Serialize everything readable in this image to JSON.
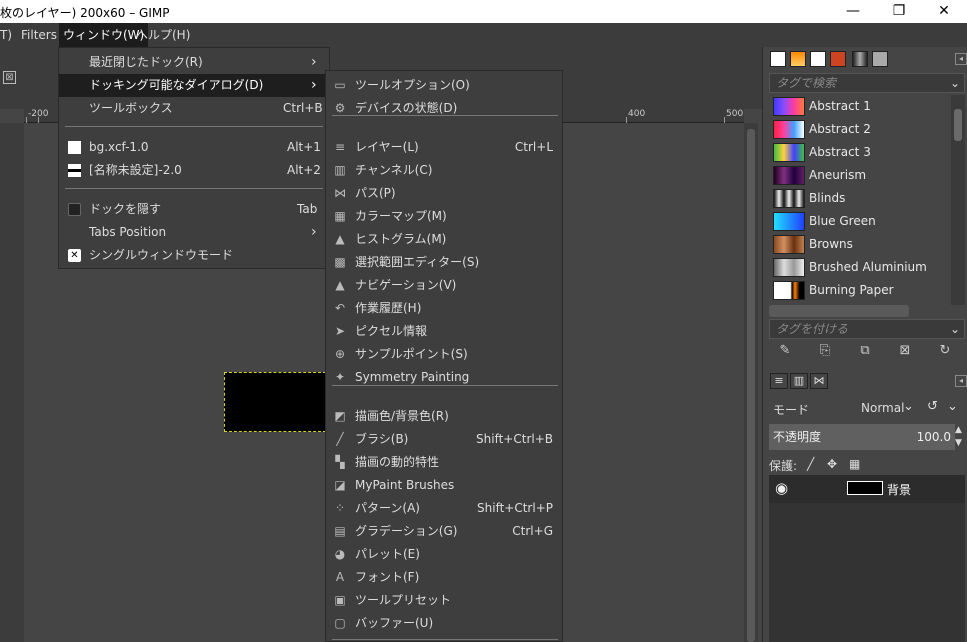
{
  "titlebar": {
    "title": "枚のレイヤー) 200x60 – GIMP",
    "minimize": "—",
    "maximize": "❐",
    "close": "✕"
  },
  "menubar": {
    "items": [
      "T)",
      "Filters",
      "ウィンドウ(W)",
      "ヘルプ(H)"
    ]
  },
  "ruler": {
    "labels": [
      "-200",
      "400",
      "500"
    ]
  },
  "window_menu": {
    "items": [
      {
        "label": "最近閉じたドック(R)",
        "arrow": "›"
      },
      {
        "label": "ドッキング可能なダイアログ(D)",
        "arrow": "›"
      },
      {
        "label": "ツールボックス",
        "shortcut": "Ctrl+B"
      },
      {
        "label": "bg.xcf-1.0",
        "shortcut": "Alt+1"
      },
      {
        "label": "[名称未設定]-2.0",
        "shortcut": "Alt+2"
      },
      {
        "label": "ドックを隠す",
        "shortcut": "Tab"
      },
      {
        "label": "Tabs Position",
        "arrow": "›"
      },
      {
        "label": "シングルウィンドウモード"
      }
    ]
  },
  "dockable_menu": {
    "items": [
      {
        "label": "ツールオプション(O)",
        "icon": "tool-options-icon",
        "glyph": "▭"
      },
      {
        "label": "デバイスの状態(D)",
        "icon": "device-status-icon",
        "glyph": "⚙"
      },
      {
        "label": "レイヤー(L)",
        "shortcut": "Ctrl+L",
        "icon": "layers-icon",
        "glyph": "≡"
      },
      {
        "label": "チャンネル(C)",
        "icon": "channels-icon",
        "glyph": "▥"
      },
      {
        "label": "パス(P)",
        "icon": "paths-icon",
        "glyph": "⋈"
      },
      {
        "label": "カラーマップ(M)",
        "icon": "colormap-icon",
        "glyph": "▦"
      },
      {
        "label": "ヒストグラム(M)",
        "icon": "histogram-icon",
        "glyph": "▲"
      },
      {
        "label": "選択範囲エディター(S)",
        "icon": "selection-editor-icon",
        "glyph": "▩"
      },
      {
        "label": "ナビゲーション(V)",
        "icon": "navigation-icon",
        "glyph": "▲"
      },
      {
        "label": "作業履歴(H)",
        "icon": "undo-history-icon",
        "glyph": "↶"
      },
      {
        "label": "ピクセル情報",
        "icon": "pointer-icon",
        "glyph": "➤"
      },
      {
        "label": "サンプルポイント(S)",
        "icon": "sample-points-icon",
        "glyph": "⊕"
      },
      {
        "label": "Symmetry Painting",
        "icon": "symmetry-icon",
        "glyph": "✦"
      },
      {
        "label": "描画色/背景色(R)",
        "icon": "fg-bg-colors-icon",
        "glyph": "◩"
      },
      {
        "label": "ブラシ(B)",
        "shortcut": "Shift+Ctrl+B",
        "icon": "brushes-icon",
        "glyph": "╱"
      },
      {
        "label": "描画の動的特性",
        "icon": "dynamics-icon",
        "glyph": "▚"
      },
      {
        "label": "MyPaint Brushes",
        "icon": "mypaint-brushes-icon",
        "glyph": "◪"
      },
      {
        "label": "パターン(A)",
        "shortcut": "Shift+Ctrl+P",
        "icon": "patterns-icon",
        "glyph": "⁘"
      },
      {
        "label": "グラデーション(G)",
        "shortcut": "Ctrl+G",
        "icon": "gradients-icon",
        "glyph": "▤"
      },
      {
        "label": "パレット(E)",
        "icon": "palettes-icon",
        "glyph": "◕"
      },
      {
        "label": "フォント(F)",
        "icon": "fonts-icon",
        "glyph": "A"
      },
      {
        "label": "ツールプリセット",
        "icon": "tool-presets-icon",
        "glyph": "▣"
      },
      {
        "label": "バッファー(U)",
        "icon": "buffers-icon",
        "glyph": "▢"
      }
    ]
  },
  "gradients": {
    "search_placeholder": "タグで検索",
    "tag_placeholder": "タグを付ける",
    "items": [
      {
        "name": "Abstract 1",
        "css": "linear-gradient(90deg,#3c3cff,#8a4bff,#ff3ca0,#ff7a3c)"
      },
      {
        "name": "Abstract 2",
        "css": "linear-gradient(90deg,#ff2040,#ff40a0,#40a0ff,#ffffff)"
      },
      {
        "name": "Abstract 3",
        "css": "linear-gradient(90deg,#40c040,#ffd040,#4040ff,#40c040)"
      },
      {
        "name": "Aneurism",
        "css": "linear-gradient(90deg,#200020,#803080,#200040,#602060)"
      },
      {
        "name": "Blinds",
        "css": "repeating-linear-gradient(90deg,#111 0px,#eee 5px,#111 10px)"
      },
      {
        "name": "Blue Green",
        "css": "linear-gradient(90deg,#20e0ff,#2040ff)"
      },
      {
        "name": "Browns",
        "css": "linear-gradient(90deg,#8a4a20,#d09060,#6a3010,#c08050)"
      },
      {
        "name": "Brushed Aluminium",
        "css": "linear-gradient(90deg,#666,#ddd,#999,#eee)"
      },
      {
        "name": "Burning Paper",
        "css": "linear-gradient(90deg,#fff 55%,#000 60%,#ff8000 70%,#000 85%)"
      }
    ]
  },
  "layers_panel": {
    "mode_label": "モード",
    "mode_value": "Normal",
    "opacity_label": "不透明度",
    "opacity_value": "100.0",
    "protect_label": "保護:",
    "layer_name": "背景"
  }
}
